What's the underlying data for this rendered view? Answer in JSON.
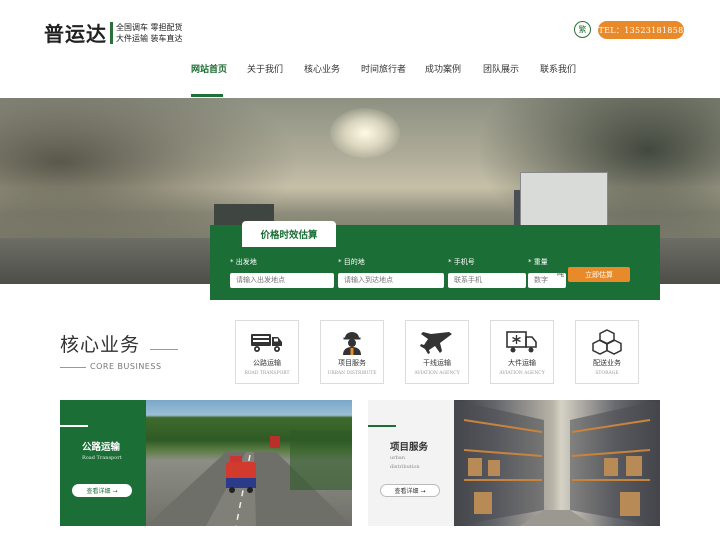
{
  "header": {
    "logo_main": "普运达",
    "logo_line1": "全国调车 零担配货",
    "logo_line2": "大件运输 装车直达",
    "lang_label": "繁",
    "tel_label": "TEL：13523181858"
  },
  "nav": {
    "items": [
      {
        "label": "网站首页"
      },
      {
        "label": "关于我们"
      },
      {
        "label": "核心业务"
      },
      {
        "label": "时间旅行者"
      },
      {
        "label": "成功案例"
      },
      {
        "label": "团队展示"
      },
      {
        "label": "联系我们"
      }
    ]
  },
  "estimate": {
    "tab_label": "价格时效估算",
    "fields": [
      {
        "label": "* 出发地",
        "placeholder": "请输入出发地点"
      },
      {
        "label": "* 目的地",
        "placeholder": "请输入到达地点"
      },
      {
        "label": "* 手机号",
        "placeholder": "联系手机"
      },
      {
        "label": "* 重量",
        "placeholder": "数字",
        "unit": "吨"
      }
    ],
    "submit_label": "立即估算"
  },
  "core": {
    "title": "核心业务",
    "subtitle": "CORE BUSINESS",
    "services": [
      {
        "name": "公路运输",
        "en": "ROAD TRANSPORT",
        "icon": "truck-icon"
      },
      {
        "name": "项目服务",
        "en": "URBAN DISTRIBUTE",
        "icon": "worker-icon"
      },
      {
        "name": "干线运输",
        "en": "AVIATION AGENCY",
        "icon": "airplane-icon"
      },
      {
        "name": "大件运输",
        "en": "AVIATION AGENCY",
        "icon": "cold-truck-icon"
      },
      {
        "name": "配送业务",
        "en": "STORAGE",
        "icon": "boxes-icon"
      }
    ]
  },
  "cards": [
    {
      "title": "公路运输",
      "en": "Road Transport",
      "btn": "查看详细 →"
    },
    {
      "title": "项目服务",
      "en_line1": "urban",
      "en_line2": "distribution",
      "btn": "查看详细 →"
    }
  ],
  "colors": {
    "brand_green": "#1b6e36",
    "accent_orange": "#e8892a"
  }
}
